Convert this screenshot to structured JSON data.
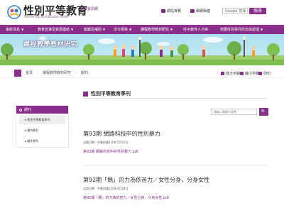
{
  "header": {
    "title": "性別平等教育",
    "subtitle": "Gender Equity Education WWW",
    "tag": "全球資訊網",
    "utils": [
      {
        "label": "網站導覽",
        "icon": "sitemap-icon"
      },
      {
        "label": "網網相連",
        "icon": "links-icon"
      }
    ],
    "search_placeholder": "Google 搜尋",
    "search_button": "搜尋"
  },
  "nav": [
    {
      "label": "最新消息",
      "caret": "▼"
    },
    {
      "label": "教育宣導及資源連結",
      "caret": "▼"
    },
    {
      "label": "獎勵及補助",
      "caret": "▼"
    },
    {
      "label": "法令規章",
      "caret": "▼"
    },
    {
      "label": "課程教學教材研究",
      "caret": "▼"
    },
    {
      "label": "性平教育人才庫",
      "caret": ""
    },
    {
      "label": "校園性別事件防治與處理",
      "caret": "▼"
    }
  ],
  "banner": {
    "title": "課程教學教材研究"
  },
  "breadcrumb": [
    "首頁",
    "課程教學教材研究",
    "期刊"
  ],
  "tools": [
    {
      "label": "放大字體",
      "icon": "zoom-in-icon"
    },
    {
      "label": "縮小字體",
      "icon": "zoom-out-icon"
    },
    {
      "label": "列印",
      "icon": "print-icon"
    }
  ],
  "page_heading": "性別平等教育季刊",
  "sidebar": {
    "heading": "期刊",
    "items": [
      {
        "label": "▸ 性別平等教育季刊",
        "active": true
      },
      {
        "label": "▸ 國內期刊",
        "active": false
      },
      {
        "label": "▸ 國外期刊",
        "active": false
      }
    ]
  },
  "keyword": {
    "placeholder": "請輸入關鍵字搜尋",
    "button": "🔍"
  },
  "entries": [
    {
      "title": "第93期 網路科技中的性別暴力",
      "meta": "出版日期：中華民國110年5月31日",
      "link": "第93期 網路科技中的性別暴力.pdf"
    },
    {
      "title": "第92期「媽」的力為依苦力／女性分身，分身女性",
      "meta": "出版日期：中華民國110年3月18日",
      "link": "第92期「媽」的力為依苦力／女性分身，分身女性.pdf"
    }
  ],
  "colors": {
    "brand": "#8b2e8b",
    "sky": "#aedff0"
  }
}
